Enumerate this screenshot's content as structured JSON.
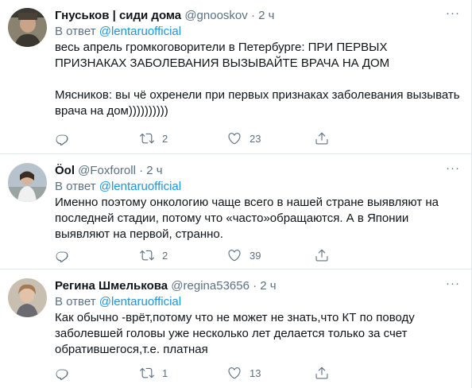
{
  "tweets": [
    {
      "name": "Гнуськов | сиди дома",
      "handle": "@gnooskov",
      "separator": "·",
      "time": "2 ч",
      "reply_prefix": "В ответ",
      "reply_mention": "@lentaruofficial",
      "text": "весь апрель громкоговорители в Петербурге: ПРИ ПЕРВЫХ ПРИЗНАКАХ ЗАБОЛЕВАНИЯ ВЫЗЫВАЙТЕ ВРАЧА НА ДОМ\n\nМясников: вы чё охренели при первых признаках заболевания вызывать врача на дом))))))))))",
      "retweets": "2",
      "likes": "23"
    },
    {
      "name": "Öol",
      "handle": "@Foxforoll",
      "separator": "·",
      "time": "2 ч",
      "reply_prefix": "В ответ",
      "reply_mention": "@lentaruofficial",
      "text": "Именно поэтому онкологию чаще всего в нашей стране выявляют на последней стадии, потому что «часто»обращаются. А в Японии выявляют на первой, странно.",
      "retweets": "2",
      "likes": "39"
    },
    {
      "name": "Регина Шмелькова",
      "handle": "@regina53656",
      "separator": "·",
      "time": "2 ч",
      "reply_prefix": "В ответ",
      "reply_mention": "@lentaruofficial",
      "text": "Как обычно -врёт,потому что не может не знать,что КТ по поводу заболевшей головы уже несколько лет делается только за счет обратившегося,т.е. платная",
      "retweets": "1",
      "likes": "13"
    }
  ],
  "icons": {
    "reply": "reply-icon",
    "retweet": "retweet-icon",
    "like": "like-icon",
    "share": "share-icon",
    "more": "more-icon"
  },
  "colors": {
    "link": "#1b95e0",
    "secondary": "#5b7083",
    "border": "#e1e8ed"
  }
}
